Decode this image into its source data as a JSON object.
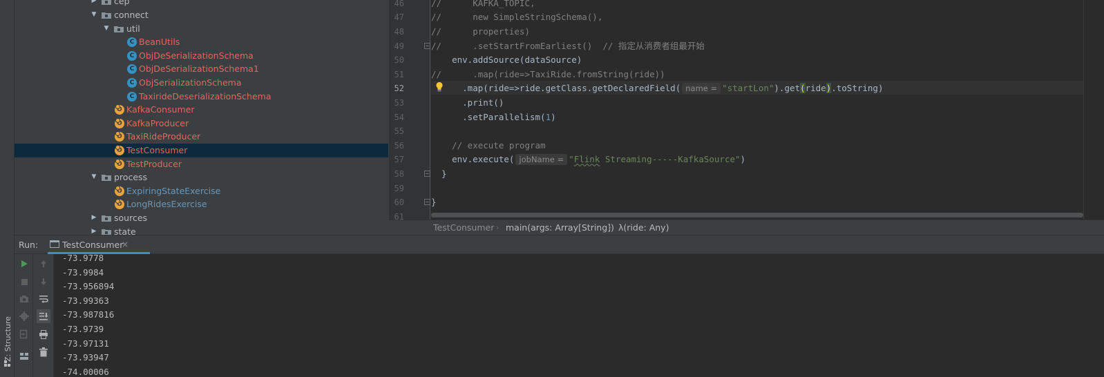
{
  "left_stripe": {
    "structure_label": "Z: Structure"
  },
  "project_tree": {
    "rows": [
      {
        "label": "cep",
        "kind": "folder",
        "expanded": false,
        "color": "plain"
      },
      {
        "label": "connect",
        "kind": "folder",
        "expanded": true,
        "color": "plain"
      },
      {
        "label": "util",
        "kind": "folder",
        "expanded": true,
        "color": "plain"
      },
      {
        "label": "BeanUtils",
        "kind": "class",
        "color": "red"
      },
      {
        "label": "ObjDeSerializationSchema",
        "kind": "class",
        "color": "red"
      },
      {
        "label": "ObjDeSerializationSchema1",
        "kind": "class",
        "color": "red"
      },
      {
        "label": "ObjSerializationSchema",
        "kind": "class",
        "color": "red"
      },
      {
        "label": "TaxirideDeserializationSchema",
        "kind": "class",
        "color": "red"
      },
      {
        "label": "KafkaConsumer",
        "kind": "object",
        "color": "red"
      },
      {
        "label": "KafkaProducer",
        "kind": "object",
        "color": "red"
      },
      {
        "label": "TaxiRideProducer",
        "kind": "object",
        "color": "red"
      },
      {
        "label": "TestConsumer",
        "kind": "object",
        "color": "red",
        "selected": true
      },
      {
        "label": "TestProducer",
        "kind": "object",
        "color": "red"
      },
      {
        "label": "process",
        "kind": "folder",
        "expanded": true,
        "color": "plain"
      },
      {
        "label": "ExpiringStateExercise",
        "kind": "object",
        "color": "blue"
      },
      {
        "label": "LongRidesExercise",
        "kind": "object",
        "color": "blue"
      },
      {
        "label": "sources",
        "kind": "folder",
        "expanded": false,
        "color": "plain"
      },
      {
        "label": "state",
        "kind": "folder",
        "expanded": false,
        "color": "plain"
      }
    ]
  },
  "editor": {
    "line_numbers": [
      "46",
      "47",
      "48",
      "49",
      "50",
      "51",
      "52",
      "53",
      "54",
      "55",
      "56",
      "57",
      "58",
      "59",
      "60",
      "61"
    ],
    "current_line": "52",
    "code": {
      "l46_comment": "//      KAFKA_TOPIC,",
      "l47_comment": "//      new SimpleStringSchema(),",
      "l48_comment": "//      properties)",
      "l49_comment": "//      .setStartFromEarliest()  // 指定从消费者组最开始",
      "l50": "    env.addSource(dataSource)",
      "l51_comment": "//      .map(ride=>TaxiRide.fromString(ride))",
      "l52_a": "      .map(ride=>ride.getClass.getDeclaredField(",
      "l52_hint": "name =",
      "l52_str": "\"startLon\"",
      "l52_b": ").get",
      "l52_paren_open": "(",
      "l52_arg": "ride",
      "l52_paren_close": ")",
      "l52_c": ".toString)",
      "l53": "      .print()",
      "l54_a": "      .setParallelism(",
      "l54_num": "1",
      "l54_b": ")",
      "l56_comment": "    // execute program",
      "l57_a": "    env.execute(",
      "l57_hint": "jobName =",
      "l57_str_q": "\"",
      "l57_str_flink": "Flink",
      "l57_str_rest": " Streaming-----KafkaSource\"",
      "l57_b": ")",
      "l58": "  }",
      "l60": "}"
    }
  },
  "breadcrumb": {
    "file": "TestConsumer",
    "method": "main(args: Array[String])",
    "lambda": "λ(ride: Any)"
  },
  "run_panel": {
    "label": "Run:",
    "tab_label": "TestConsumer",
    "close": "×",
    "output": [
      "-73.9778",
      "-73.9984",
      "-73.956894",
      "-73.99363",
      "-73.987816",
      "-73.9739",
      "-73.97131",
      "-73.93947",
      "-74.00006"
    ]
  },
  "colors": {
    "selection": "#0d293e",
    "accent": "#4a88c7",
    "run_green": "#499c54"
  }
}
